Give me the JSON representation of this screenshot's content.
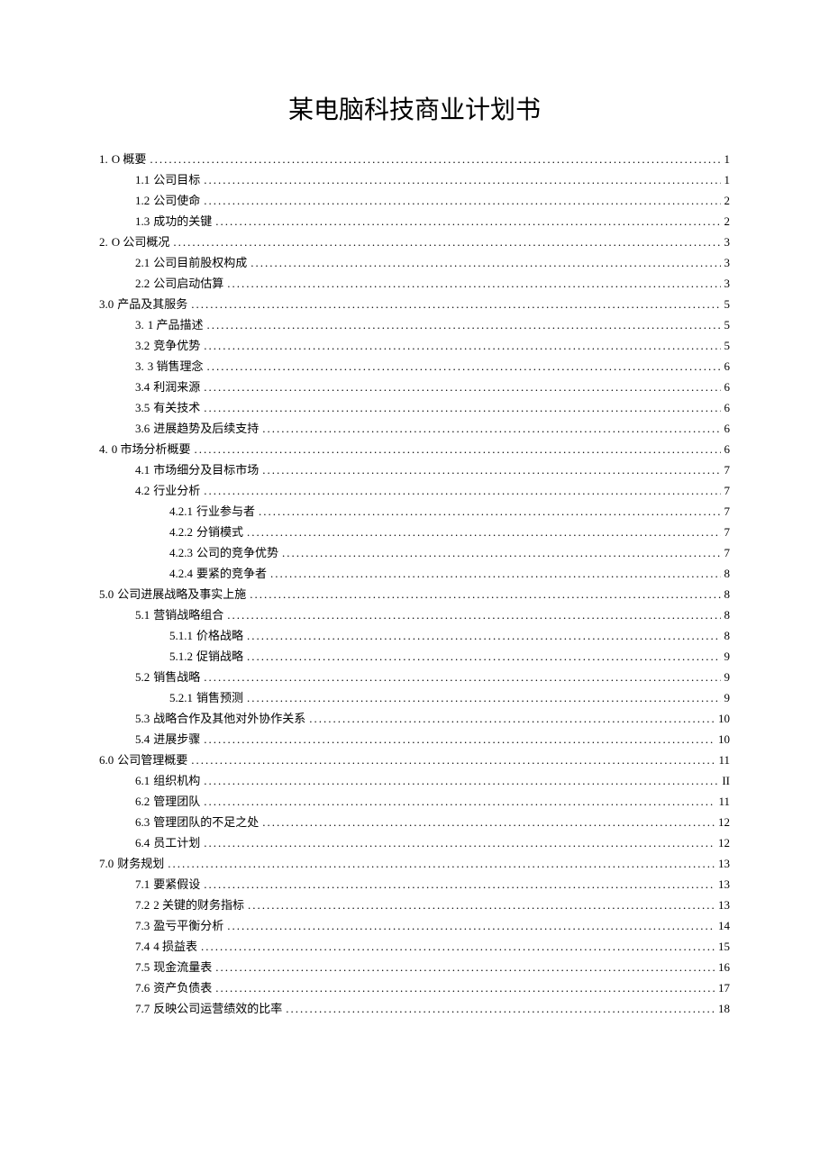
{
  "title": "某电脑科技商业计划书",
  "toc": [
    {
      "num": "1.",
      "label": "O 概要",
      "page": "1",
      "indent": 0
    },
    {
      "num": "1.1",
      "label": "公司目标",
      "page": "1",
      "indent": 1
    },
    {
      "num": "1.2",
      "label": "公司使命",
      "page": "2",
      "indent": 1
    },
    {
      "num": "1.3",
      "label": "成功的关键",
      "page": "2",
      "indent": 1
    },
    {
      "num": "2.",
      "label": "O 公司概况",
      "page": "3",
      "indent": 0
    },
    {
      "num": "2.1",
      "label": "公司目前股权构成",
      "page": "3",
      "indent": 1
    },
    {
      "num": "2.2",
      "label": "公司启动估算",
      "page": "3",
      "indent": 1
    },
    {
      "num": "3.0",
      "label": "产品及其服务",
      "page": "5",
      "indent": 0
    },
    {
      "num": "3.",
      "label": "1 产品描述",
      "page": "5",
      "indent": 1
    },
    {
      "num": "3.2",
      "label": "竞争优势",
      "page": "5",
      "indent": 1
    },
    {
      "num": "3.",
      "label": "3 销售理念",
      "page": "6",
      "indent": 1
    },
    {
      "num": "3.4",
      "label": "利润来源",
      "page": "6",
      "indent": 1
    },
    {
      "num": "3.5",
      "label": "有关技术",
      "page": "6",
      "indent": 1
    },
    {
      "num": "3.6",
      "label": "进展趋势及后续支持",
      "page": "6",
      "indent": 1
    },
    {
      "num": "4.",
      "label": "0 市场分析概要",
      "page": "6",
      "indent": 0
    },
    {
      "num": "4.1",
      "label": "市场细分及目标市场",
      "page": "7",
      "indent": 1
    },
    {
      "num": "4.2",
      "label": "行业分析",
      "page": "7",
      "indent": 1
    },
    {
      "num": "4.2.1",
      "label": "行业参与者",
      "page": "7",
      "indent": 2
    },
    {
      "num": "4.2.2",
      "label": "分销模式",
      "page": "7",
      "indent": 2
    },
    {
      "num": "4.2.3",
      "label": "公司的竞争优势",
      "page": "7",
      "indent": 2
    },
    {
      "num": "4.2.4",
      "label": "要紧的竞争者",
      "page": "8",
      "indent": 2
    },
    {
      "num": "5.0",
      "label": "公司进展战略及事实上施",
      "page": "8",
      "indent": 0
    },
    {
      "num": "5.1",
      "label": "营销战略组合",
      "page": "8",
      "indent": 1
    },
    {
      "num": "5.1.1",
      "label": "价格战略",
      "page": "8",
      "indent": 2
    },
    {
      "num": "5.1.2",
      "label": "促销战略",
      "page": "9",
      "indent": 2
    },
    {
      "num": "5.2",
      "label": "销售战略",
      "page": "9",
      "indent": 1
    },
    {
      "num": "5.2.1",
      "label": "销售预测",
      "page": "9",
      "indent": 2
    },
    {
      "num": "5.3",
      "label": "战略合作及其他对外协作关系",
      "page": "10",
      "indent": 1
    },
    {
      "num": "5.4",
      "label": "进展步骤",
      "page": "10",
      "indent": 1
    },
    {
      "num": "6.0",
      "label": "公司管理概要",
      "page": "11",
      "indent": 0
    },
    {
      "num": "6.1",
      "label": "组织机构",
      "page": "II",
      "indent": 1
    },
    {
      "num": "6.2",
      "label": "管理团队",
      "page": "11",
      "indent": 1
    },
    {
      "num": "6.3",
      "label": "管理团队的不足之处",
      "page": "12",
      "indent": 1
    },
    {
      "num": "6.4",
      "label": "员工计划",
      "page": "12",
      "indent": 1
    },
    {
      "num": "7.0",
      "label": "财务规划",
      "page": "13",
      "indent": 0
    },
    {
      "num": "7.1",
      "label": "要紧假设",
      "page": "13",
      "indent": 1
    },
    {
      "num": "7.2",
      "label": "2 关键的财务指标",
      "page": "13",
      "indent": 1
    },
    {
      "num": "7.3",
      "label": "盈亏平衡分析",
      "page": "14",
      "indent": 1
    },
    {
      "num": "7.4",
      "label": "4 损益表",
      "page": "15",
      "indent": 1
    },
    {
      "num": "7.5",
      "label": "现金流量表",
      "page": "16",
      "indent": 1
    },
    {
      "num": "7.6",
      "label": "资产负债表",
      "page": "17",
      "indent": 1
    },
    {
      "num": "7.7",
      "label": "反映公司运营绩效的比率",
      "page": "18",
      "indent": 1
    }
  ]
}
